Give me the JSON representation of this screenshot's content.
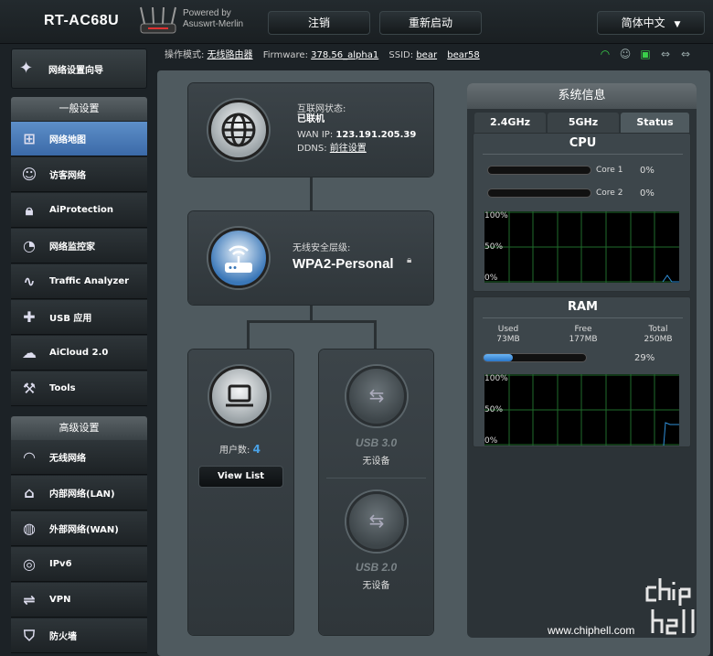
{
  "header": {
    "model": "RT-AC68U",
    "powered_by": "Powered by",
    "powered_firmware": "Asuswrt-Merlin",
    "logout": "注销",
    "reboot": "重新启动",
    "language": "简体中文"
  },
  "status": {
    "mode_label": "操作模式:",
    "mode_value": "无线路由器",
    "fw_label": "Firmware:",
    "fw_value": "378.56_alpha1",
    "ssid_label": "SSID:",
    "ssid_1": "bear",
    "ssid_2": "bear58"
  },
  "sidebar": {
    "qis": "网络设置向导",
    "general_title": "一般设置",
    "general": [
      {
        "label": "网络地图",
        "icon": "network-map-icon"
      },
      {
        "label": "访客网络",
        "icon": "guest-network-icon"
      },
      {
        "label": "AiProtection",
        "icon": "lock-icon"
      },
      {
        "label": "网络监控家",
        "icon": "gauge-icon"
      },
      {
        "label": "Traffic Analyzer",
        "icon": "chart-icon"
      },
      {
        "label": "USB 应用",
        "icon": "puzzle-icon"
      },
      {
        "label": "AiCloud 2.0",
        "icon": "cloud-icon"
      },
      {
        "label": "Tools",
        "icon": "wrench-icon"
      }
    ],
    "advanced_title": "高级设置",
    "advanced": [
      {
        "label": "无线网络",
        "icon": "wifi-icon"
      },
      {
        "label": "内部网络(LAN)",
        "icon": "home-icon"
      },
      {
        "label": "外部网络(WAN)",
        "icon": "globe-icon"
      },
      {
        "label": "IPv6",
        "icon": "ipv6-icon"
      },
      {
        "label": "VPN",
        "icon": "vpn-icon"
      },
      {
        "label": "防火墙",
        "icon": "shield-icon"
      }
    ]
  },
  "network_map": {
    "internet_status_label": "互联网状态:",
    "internet_status_value": "已联机",
    "wan_ip_label": "WAN IP:",
    "wan_ip_value": "123.191.205.39",
    "ddns_label": "DDNS:",
    "ddns_value": "前往设置",
    "wireless_security_label": "无线安全层级:",
    "wireless_security_value": "WPA2-Personal",
    "clients_label": "用户数:",
    "clients_value": "4",
    "view_list": "View List",
    "usb1_label": "USB 3.0",
    "usb1_status": "无设备",
    "usb2_label": "USB 2.0",
    "usb2_status": "无设备"
  },
  "sysinfo": {
    "title": "系统信息",
    "tabs": [
      "2.4GHz",
      "5GHz",
      "Status"
    ],
    "active_tab": "Status",
    "cpu_title": "CPU",
    "cores": [
      {
        "name": "Core 1",
        "usage": "0%",
        "value": 0
      },
      {
        "name": "Core 2",
        "usage": "0%",
        "value": 0
      }
    ],
    "cpu_graph_ticks": [
      "100%",
      "50%",
      "0%"
    ],
    "ram_title": "RAM",
    "ram_used_label": "Used",
    "ram_used": "73MB",
    "ram_free_label": "Free",
    "ram_free": "177MB",
    "ram_total_label": "Total",
    "ram_total": "250MB",
    "ram_percent": "29%",
    "ram_value": 0.29,
    "ram_graph_ticks": [
      "100%",
      "50%",
      "0%"
    ]
  },
  "watermark": {
    "url": "www.chiphell.com"
  },
  "colors": {
    "accent_blue": "#3b6aa8",
    "graph_line": "#2f8fd9",
    "graph_grid": "#1f6b2b",
    "wifi_green": "#3ad04a"
  }
}
